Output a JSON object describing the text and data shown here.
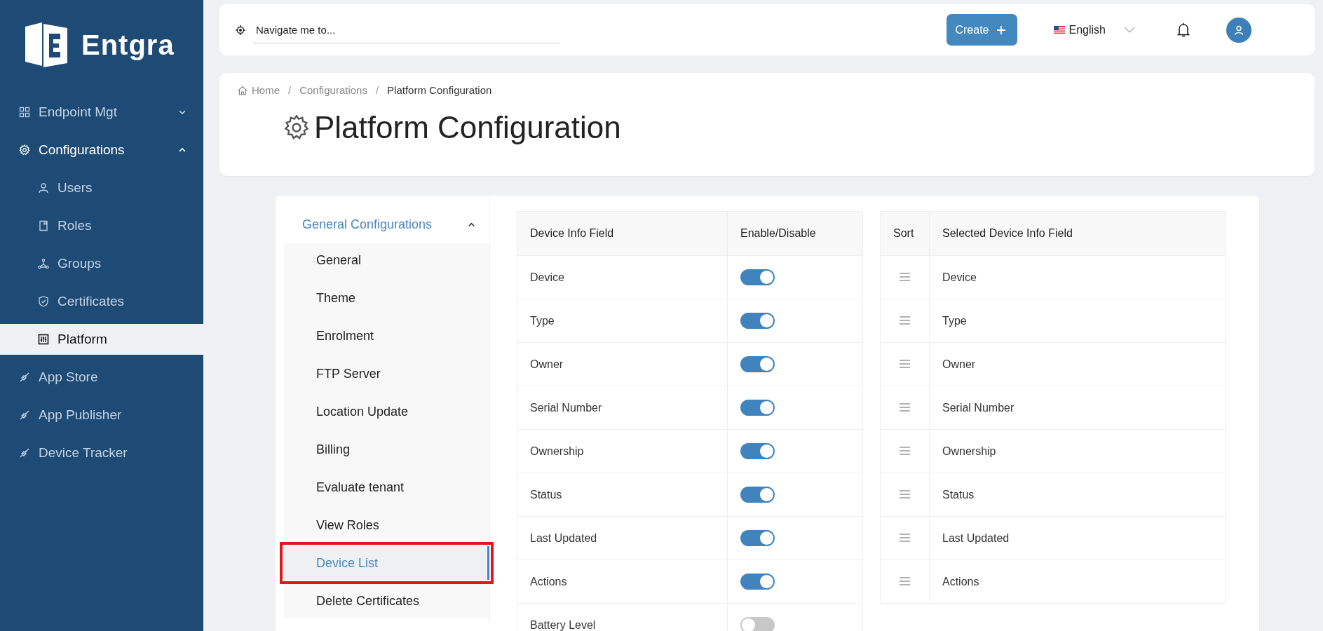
{
  "sidebar": {
    "logo": "Entgra",
    "items": [
      {
        "label": "Endpoint Mgt",
        "kind": "grid",
        "selected": false,
        "expanded": false
      },
      {
        "label": "Configurations",
        "kind": "gear",
        "selected": false,
        "expanded": true,
        "children": [
          {
            "label": "Users",
            "kind": "user",
            "selected": false
          },
          {
            "label": "Roles",
            "kind": "book",
            "selected": false
          },
          {
            "label": "Groups",
            "kind": "nodes",
            "selected": false
          },
          {
            "label": "Certificates",
            "kind": "shield",
            "selected": false
          },
          {
            "label": "Platform",
            "kind": "sliders",
            "selected": true
          }
        ]
      },
      {
        "label": "App Store",
        "kind": "plug",
        "selected": false
      },
      {
        "label": "App Publisher",
        "kind": "plug",
        "selected": false
      },
      {
        "label": "Device Tracker",
        "kind": "plug",
        "selected": false
      }
    ]
  },
  "topbar": {
    "search": {
      "placeholder": "Navigate me to..."
    },
    "create_button": "Create",
    "language": "English"
  },
  "breadcrumb": {
    "separator": "/",
    "items": [
      "Home",
      "Configurations",
      "Platform Configuration"
    ]
  },
  "page_title": "Platform Configuration",
  "settings_menu": {
    "group": "General Configurations",
    "expanded": true,
    "items": [
      {
        "label": "General",
        "selected": false,
        "annotated": false
      },
      {
        "label": "Theme",
        "selected": false,
        "annotated": false
      },
      {
        "label": "Enrolment",
        "selected": false,
        "annotated": false
      },
      {
        "label": "FTP Server",
        "selected": false,
        "annotated": false
      },
      {
        "label": "Location Update",
        "selected": false,
        "annotated": false
      },
      {
        "label": "Billing",
        "selected": false,
        "annotated": false
      },
      {
        "label": "Evaluate tenant",
        "selected": false,
        "annotated": false
      },
      {
        "label": "View Roles",
        "selected": false,
        "annotated": false
      },
      {
        "label": "Device List",
        "selected": true,
        "annotated": true
      },
      {
        "label": "Delete Certificates",
        "selected": false,
        "annotated": false
      }
    ]
  },
  "fields_table": {
    "columns": [
      "Device Info Field",
      "Enable/Disable"
    ],
    "rows": [
      {
        "field": "Device",
        "enabled": true
      },
      {
        "field": "Type",
        "enabled": true
      },
      {
        "field": "Owner",
        "enabled": true
      },
      {
        "field": "Serial Number",
        "enabled": true
      },
      {
        "field": "Ownership",
        "enabled": true
      },
      {
        "field": "Status",
        "enabled": true
      },
      {
        "field": "Last Updated",
        "enabled": true
      },
      {
        "field": "Actions",
        "enabled": true
      },
      {
        "field": "Battery Level",
        "enabled": false
      }
    ]
  },
  "selected_table": {
    "columns": [
      "Sort",
      "Selected Device Info Field"
    ],
    "rows": [
      "Device",
      "Type",
      "Owner",
      "Serial Number",
      "Ownership",
      "Status",
      "Last Updated",
      "Actions"
    ]
  }
}
